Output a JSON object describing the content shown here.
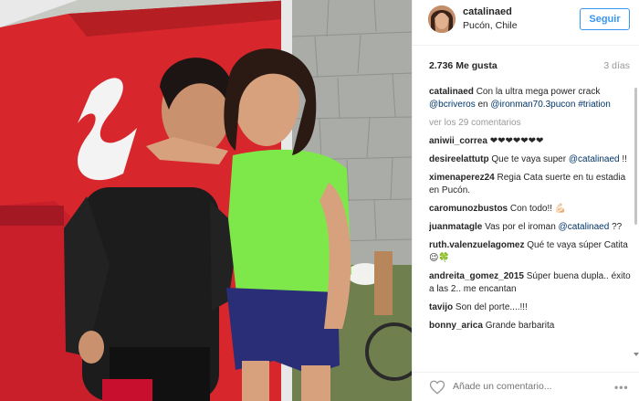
{
  "post": {
    "username": "catalinaed",
    "location": "Pucón, Chile",
    "follow_label": "Seguir",
    "likes": "2.736 Me gusta",
    "time": "3 días"
  },
  "caption": {
    "username": "catalinaed",
    "text_before": " Con la ultra mega power crack ",
    "mention1": "@bcriveros",
    "text_mid": " en ",
    "mention2": "@ironman70.3pucon",
    "text_space": " ",
    "hashtag": "#triation"
  },
  "view_all": "ver los 29 comentarios",
  "comments": [
    {
      "user": "aniwii_correa",
      "text": " ❤❤❤❤❤❤❤"
    },
    {
      "user": "desireelattutp",
      "text": " Que te vaya super ",
      "mention": "@catalinaed",
      "tail": " !!"
    },
    {
      "user": "ximenaperez24",
      "text": " Regia Cata suerte en tu estadia en Pucón."
    },
    {
      "user": "caromunozbustos",
      "text": " Con todo!! 💪🏻"
    },
    {
      "user": "juanmatagle",
      "text": " Vas por el iroman ",
      "mention": "@catalinaed",
      "tail": " ??"
    },
    {
      "user": "ruth.valenzuelagomez",
      "text": " Qué te vaya súper Catita 😉🍀"
    },
    {
      "user": "andreita_gomez_2015",
      "text": " Súper buena dupla.. éxito a las 2.. me encantan"
    },
    {
      "user": "tavijo",
      "text": " Son del porte....!!!"
    },
    {
      "user": "bonny_arica",
      "text": " Grande barbarita"
    }
  ],
  "footer": {
    "placeholder": "Añade un comentario...",
    "more": "•••"
  },
  "icons": {
    "heart": "heart-icon",
    "more": "more-options-icon"
  },
  "colors": {
    "accent": "#3897f0",
    "link": "#003569",
    "muted": "#999999"
  }
}
